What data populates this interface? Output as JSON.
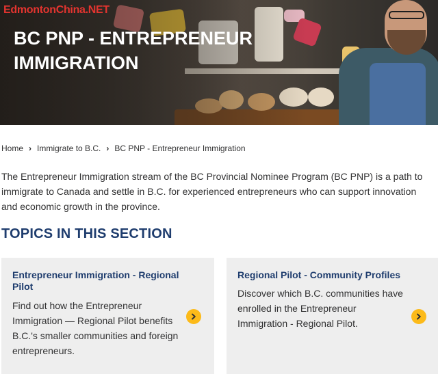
{
  "watermark": "EdmontonChina.NET",
  "hero": {
    "title": "BC PNP - ENTREPRENEUR IMMIGRATION"
  },
  "breadcrumb": [
    {
      "label": "Home"
    },
    {
      "label": "Immigrate to B.C."
    },
    {
      "label": "BC PNP - Entrepreneur Immigration"
    }
  ],
  "intro": "The Entrepreneur Immigration stream of the BC Provincial Nominee Program (BC PNP) is a path to immigrate to Canada and settle in B.C. for experienced entrepreneurs who can support innovation and economic growth in the province.",
  "topics": {
    "heading": "TOPICS IN THIS SECTION",
    "cards": [
      {
        "title": "Entrepreneur Immigration - Regional Pilot",
        "description": "Find out how the Entrepreneur Immigration — Regional Pilot benefits B.C.'s smaller communities and foreign entrepreneurs.",
        "icon": "chevron-right-icon"
      },
      {
        "title": "Regional Pilot - Community Profiles",
        "description": "Discover which B.C. communities have enrolled in the Entrepreneur Immigration - Regional Pilot.",
        "icon": "chevron-right-icon"
      }
    ]
  },
  "colors": {
    "heading_blue": "#1f3d6e",
    "accent_yellow": "#fcba19",
    "card_bg": "#eeeeee",
    "watermark_red": "#e3342f"
  }
}
